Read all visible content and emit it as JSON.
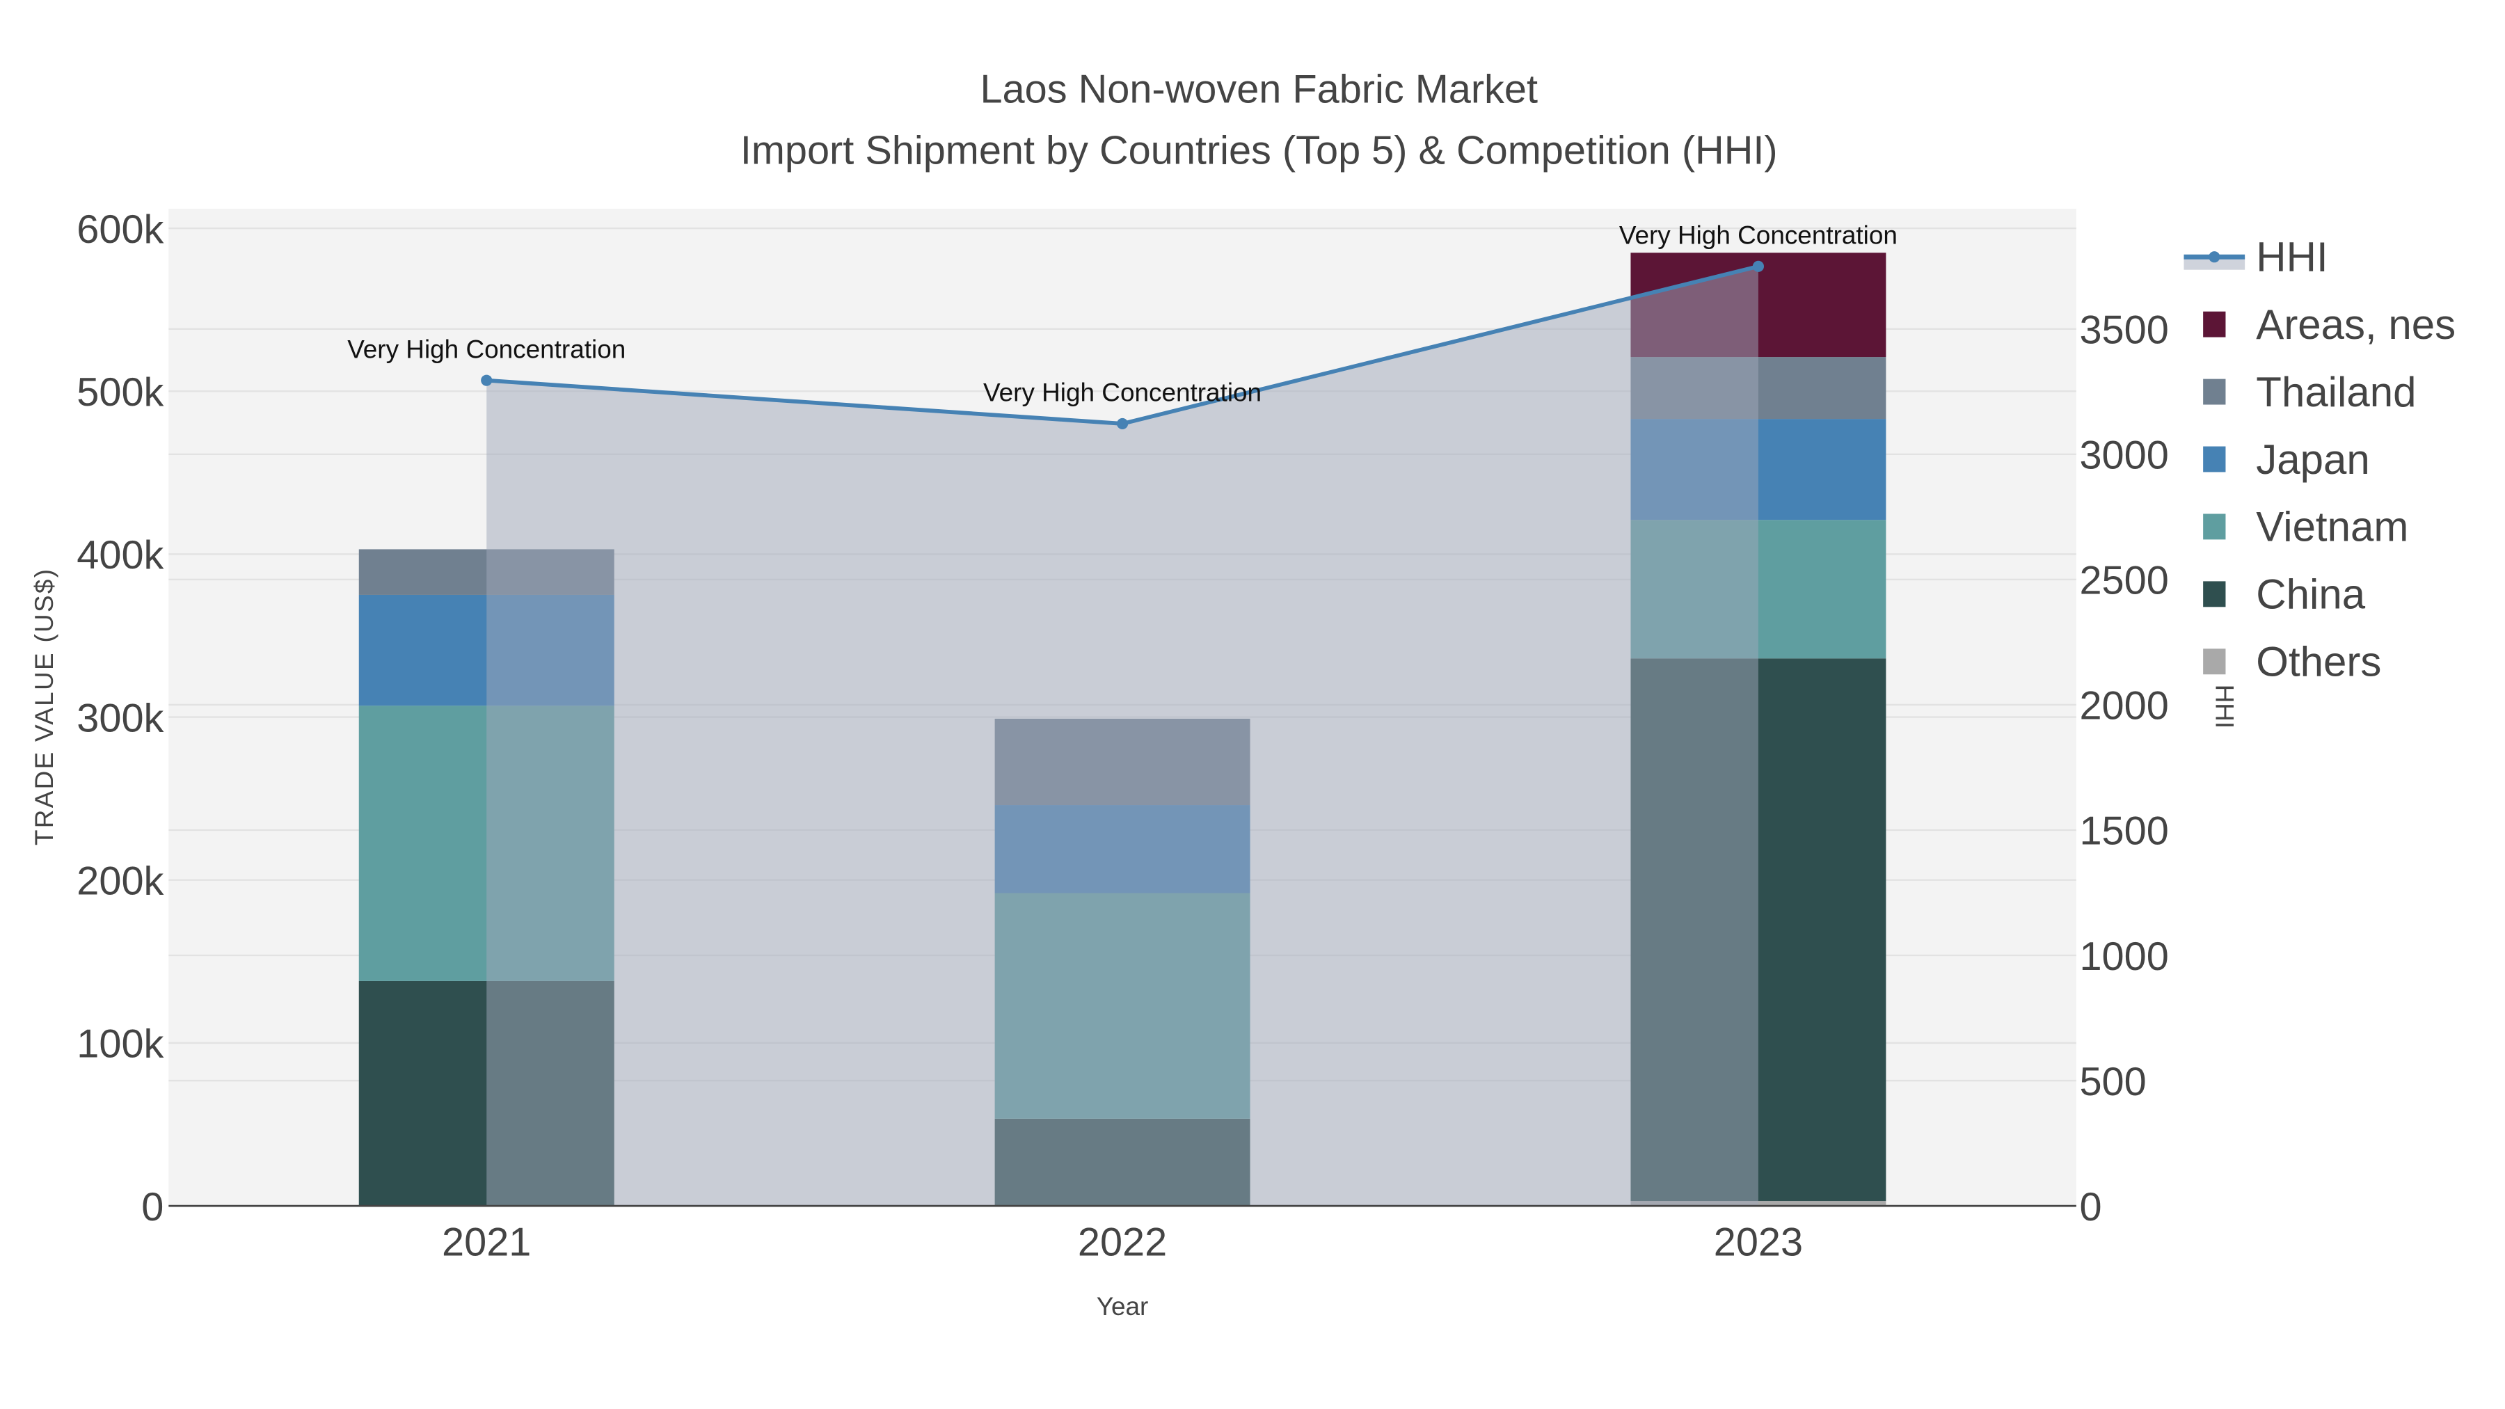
{
  "chart_data": {
    "type": "bar",
    "title": "Laos Non-woven Fabric Market",
    "subtitle": "Import Shipment by Countries (Top 5) & Competition (HHI)",
    "xlabel": "Year",
    "ylabel": "TRADE VALUE (US$)",
    "y2label": "HHI",
    "categories": [
      "2021",
      "2022",
      "2023"
    ],
    "ylim": [
      0,
      612000
    ],
    "y2lim": [
      0,
      3980
    ],
    "yticks": [
      {
        "v": 0,
        "label": "0"
      },
      {
        "v": 100000,
        "label": "100k"
      },
      {
        "v": 200000,
        "label": "200k"
      },
      {
        "v": 300000,
        "label": "300k"
      },
      {
        "v": 400000,
        "label": "400k"
      },
      {
        "v": 500000,
        "label": "500k"
      },
      {
        "v": 600000,
        "label": "600k"
      }
    ],
    "y2ticks": [
      {
        "v": 0,
        "label": "0"
      },
      {
        "v": 500,
        "label": "500"
      },
      {
        "v": 1000,
        "label": "1000"
      },
      {
        "v": 1500,
        "label": "1500"
      },
      {
        "v": 2000,
        "label": "2000"
      },
      {
        "v": 2500,
        "label": "2500"
      },
      {
        "v": 3000,
        "label": "3000"
      },
      {
        "v": 3500,
        "label": "3500"
      }
    ],
    "grid": true,
    "stacked": true,
    "legend_position": "right",
    "series": [
      {
        "name": "Others",
        "color": "#a9a9a9",
        "values": [
          0,
          0,
          3000
        ]
      },
      {
        "name": "China",
        "color": "#2f4f4f",
        "values": [
          138000,
          53500,
          333000
        ]
      },
      {
        "name": "Vietnam",
        "color": "#5f9ea0",
        "values": [
          169000,
          138500,
          85000
        ]
      },
      {
        "name": "Japan",
        "color": "#4682b4",
        "values": [
          68000,
          54000,
          62000
        ]
      },
      {
        "name": "Thailand",
        "color": "#708090",
        "values": [
          28000,
          53000,
          38000
        ]
      },
      {
        "name": "Areas, nes",
        "color": "#5c1536",
        "values": [
          0,
          0,
          64000
        ]
      }
    ],
    "hhi": {
      "name": "HHI",
      "color": "#4682b4",
      "values": [
        3295,
        3122,
        3750
      ],
      "fill": "area"
    },
    "annotations": [
      "Very High Concentration",
      "Very High Concentration",
      "Very High Concentration"
    ],
    "legend_order": [
      "HHI",
      "Areas, nes",
      "Thailand",
      "Japan",
      "Vietnam",
      "China",
      "Others"
    ]
  }
}
